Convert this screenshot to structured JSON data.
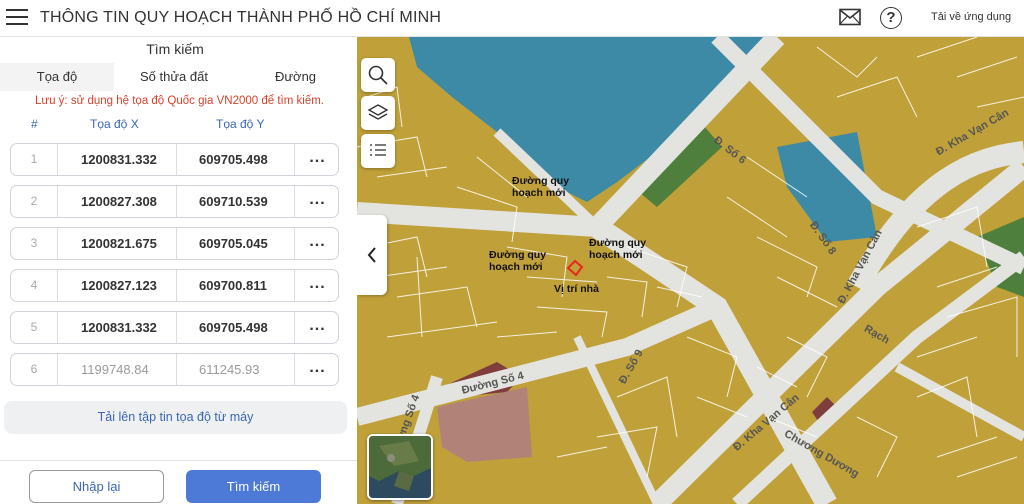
{
  "header": {
    "title": "THÔNG TIN QUY HOẠCH THÀNH PHỐ HỒ CHÍ MINH",
    "download_label": "Tải về ứng dụng",
    "menu_icon": "hamburger-menu-icon",
    "mail_icon": "mail-icon",
    "help_icon": "help-icon",
    "help_glyph": "?"
  },
  "panel": {
    "title": "Tìm kiếm",
    "tabs": [
      {
        "label": "Tọa độ",
        "active": true
      },
      {
        "label": "Số thửa đất",
        "active": false
      },
      {
        "label": "Đường",
        "active": false
      }
    ],
    "note": "Lưu ý: sử dụng hệ tọa độ Quốc gia VN2000 để tìm kiếm.",
    "columns": [
      "#",
      "Tọa độ X",
      "Tọa độ Y"
    ],
    "rows": [
      {
        "num": "1",
        "x": "1200831.332",
        "y": "609705.498",
        "more": "..."
      },
      {
        "num": "2",
        "x": "1200827.308",
        "y": "609710.539",
        "more": "..."
      },
      {
        "num": "3",
        "x": "1200821.675",
        "y": "609705.045",
        "more": "..."
      },
      {
        "num": "4",
        "x": "1200827.123",
        "y": "609700.811",
        "more": "..."
      },
      {
        "num": "5",
        "x": "1200831.332",
        "y": "609705.498",
        "more": "..."
      }
    ],
    "placeholder_row": {
      "num": "6",
      "x": "1199748.84",
      "y": "611245.93",
      "more": "..."
    },
    "upload_label": "Tải lên tập tin tọa độ từ máy",
    "reset_label": "Nhập lại",
    "search_label": "Tìm kiếm",
    "colors": {
      "accent": "#4c7ad6",
      "link": "#3a66b5",
      "warning": "#d9412b"
    }
  },
  "map": {
    "labels": {
      "new_road_1": "Đường quy hoạch mới",
      "new_road_2": "Đường quy hoạch mới",
      "new_road_3": "Đường quy hoạch mới",
      "house_location": "Vị trí nhà"
    },
    "streets": {
      "so4": "Đường Số 4",
      "so4_side": "Đường Số 4",
      "so6": "Đ. Số 6",
      "so8": "Đ. Số 8",
      "kha_van_can_top": "Đ. Kha Vạn Cân",
      "kha_van_can_mid": "Đ. Kha Vạn Cân",
      "kha_van_can_bottom": "Đ. Kha Vạn Cân",
      "chuong_duong": "Chương Dương",
      "so9": "Đ. Số 9",
      "rach": "Rạch"
    },
    "tools": [
      "search-icon",
      "layers-icon",
      "legend-list-icon"
    ],
    "collapse_icon": "chevron-left-icon",
    "colors": {
      "residential": "#c0a039",
      "road": "#e6e6e3",
      "water": "#3c8aa6",
      "green": "#4f7f3c",
      "public": "#8c4a4a",
      "highlight": "#e8261e"
    }
  }
}
